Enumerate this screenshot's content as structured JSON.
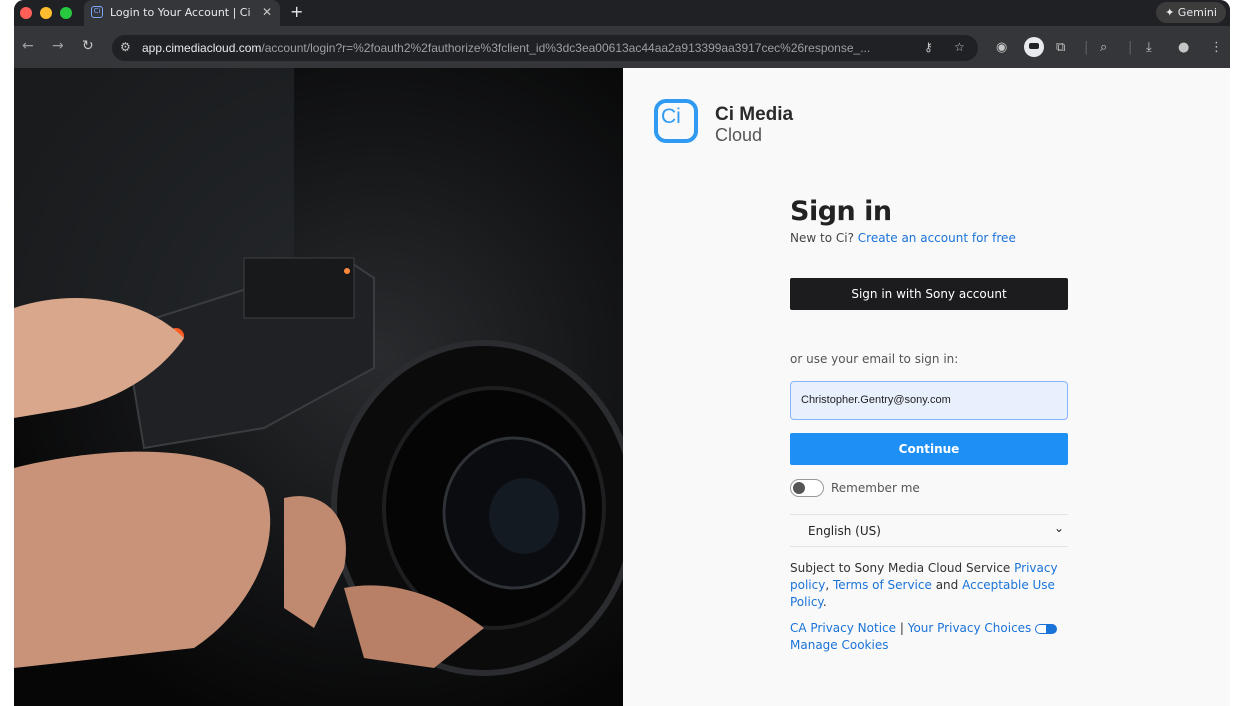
{
  "browser": {
    "tab_title": "Login to Your Account | Ci Me",
    "favicon_letter": "Ci",
    "close_glyph": "✕",
    "new_tab_glyph": "+",
    "gemini_label": "✦ Gemini",
    "url_host": "app.cimediacloud.com",
    "url_path": "/account/login?r=%2foauth2%2fauthorize%3fclient_id%3dc3ea00613ac44aa2a913399aa3917cec%26response_...",
    "traffic_colors": [
      "#ff5f57",
      "#febc2e",
      "#28c840"
    ]
  },
  "brand": {
    "logo_mark": "Ci",
    "name_line1": "Ci Media",
    "name_line2": "Cloud",
    "accent": "#2f9af2"
  },
  "signin": {
    "title": "Sign in",
    "new_prefix": "New to Ci?",
    "create_link": "Create an account for free",
    "sony_button": "Sign in with Sony account",
    "or_text": "or use your email to sign in:",
    "email_value": "Christopher.Gentry@sony.com",
    "continue_button": "Continue",
    "remember_label": "Remember me",
    "language": "English (US)",
    "language_chevron": "⌄"
  },
  "legal": {
    "prefix": "Subject to Sony Media Cloud Service",
    "privacy_policy": "Privacy policy",
    "comma": ",",
    "terms": "Terms of Service",
    "and": "and",
    "aup": "Acceptable Use Policy",
    "period": ".",
    "ca_notice": "CA Privacy Notice",
    "separator": "|",
    "privacy_choices": "Your Privacy Choices",
    "manage_cookies": "Manage Cookies"
  }
}
